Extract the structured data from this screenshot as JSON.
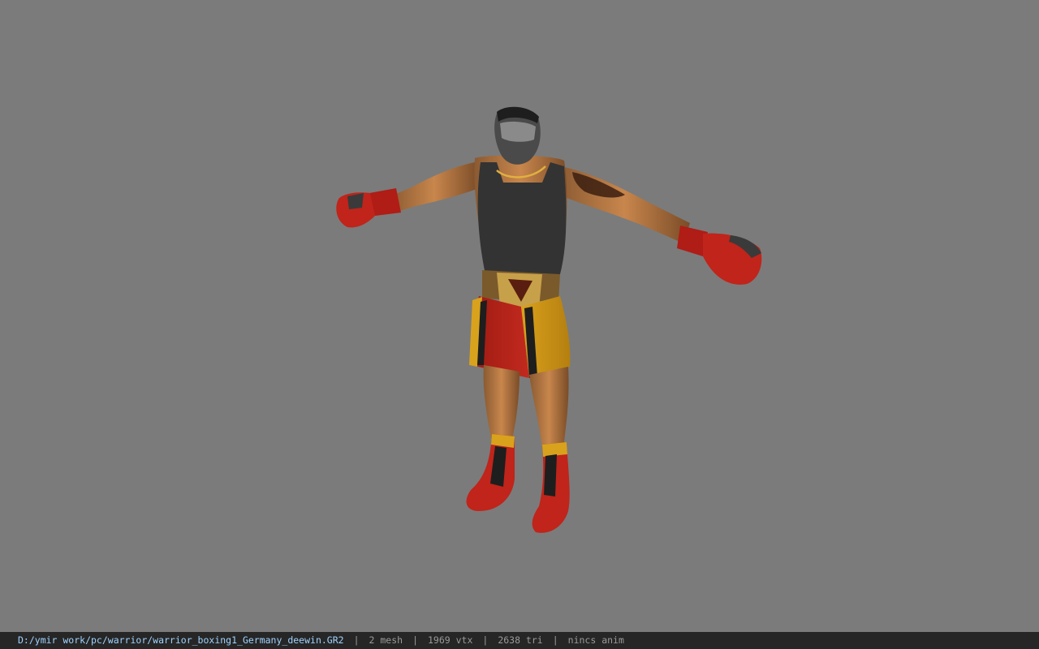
{
  "status_bar": {
    "file_path": "D:/ymir work/pc/warrior/warrior_boxing1_Germany_deewin.GR2",
    "mesh_count": "2 mesh",
    "vertex_count": "1969 vtx",
    "triangle_count": "2638 tri",
    "animation": "nincs anim",
    "separator": "|"
  },
  "colors": {
    "viewport_background": "#7b7b7b",
    "statusbar_background": "#262626",
    "path_text": "#9fd3ff",
    "info_text": "#9a9a9a"
  }
}
